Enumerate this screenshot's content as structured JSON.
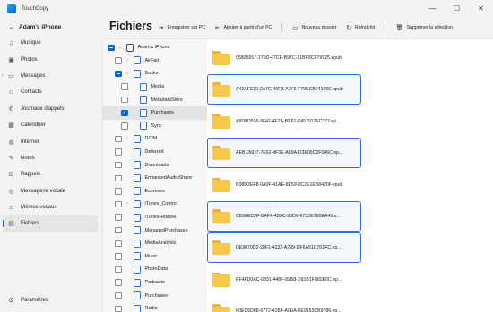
{
  "app": {
    "title": "TouchCopy"
  },
  "window_controls": {
    "minimize": "—",
    "maximize": "☐",
    "close": "✕"
  },
  "sidebar": {
    "device_name": "Adam's iPhone",
    "items": [
      {
        "label": "Musique",
        "icon": "music-icon",
        "glyph": "♫",
        "active": false
      },
      {
        "label": "Photos",
        "icon": "photo-icon",
        "glyph": "▣",
        "active": false
      },
      {
        "label": "Messages",
        "icon": "message-icon",
        "glyph": "▭",
        "active": false,
        "expander": "›"
      },
      {
        "label": "Contacts",
        "icon": "contacts-icon",
        "glyph": "☺",
        "active": false
      },
      {
        "label": "Journaux d'appels",
        "icon": "call-log-icon",
        "glyph": "✆",
        "active": false
      },
      {
        "label": "Calendrier",
        "icon": "calendar-icon",
        "glyph": "▦",
        "active": false
      },
      {
        "label": "Internet",
        "icon": "globe-icon",
        "glyph": "◍",
        "active": false
      },
      {
        "label": "Notes",
        "icon": "notes-icon",
        "glyph": "✎",
        "active": false
      },
      {
        "label": "Rappels",
        "icon": "reminders-icon",
        "glyph": "☑",
        "active": false
      },
      {
        "label": "Messagerie vocale",
        "icon": "voicemail-icon",
        "glyph": "◎",
        "active": false
      },
      {
        "label": "Mémos vocaux",
        "icon": "voice-memo-icon",
        "glyph": "♬",
        "active": false
      },
      {
        "label": "Fichiers",
        "icon": "files-icon",
        "glyph": "▤",
        "active": true
      }
    ],
    "settings_label": "Paramètres"
  },
  "header": {
    "title": "Fichiers",
    "toolbar": [
      {
        "label": "Enregistrer sur PC",
        "icon": "save-to-pc-icon",
        "glyph": "⇥",
        "name": "save-to-pc-button"
      },
      {
        "label": "Ajouter à partir d'un PC",
        "icon": "add-from-pc-icon",
        "glyph": "⇤",
        "name": "add-from-pc-button"
      },
      {
        "label": "Nouveau dossier",
        "icon": "new-folder-icon",
        "glyph": "▭",
        "name": "new-folder-button"
      },
      {
        "label": "Rafraîchir",
        "icon": "refresh-icon",
        "glyph": "↻",
        "name": "refresh-button"
      },
      {
        "label": "Supprimer la sélection",
        "icon": "trash-icon",
        "glyph": "🗑",
        "name": "delete-selection-button"
      }
    ]
  },
  "tree": {
    "rows": [
      {
        "label": "Adam's iPhone",
        "level": 0,
        "check": "partial",
        "expander": "⌄",
        "icon": "phone"
      },
      {
        "label": "AirFair",
        "level": 1,
        "check": "none",
        "expander": "›",
        "icon": "app"
      },
      {
        "label": "Books",
        "level": 1,
        "check": "partial",
        "expander": "⌄",
        "icon": "app"
      },
      {
        "label": "Media",
        "level": 2,
        "check": "none",
        "expander": "",
        "icon": "app"
      },
      {
        "label": "MetadataStore",
        "level": 2,
        "check": "none",
        "expander": "",
        "icon": "app"
      },
      {
        "label": "Purchases",
        "level": 2,
        "check": "checked",
        "expander": "",
        "icon": "app",
        "selected": true
      },
      {
        "label": "Sync",
        "level": 2,
        "check": "none",
        "expander": "",
        "icon": "app"
      },
      {
        "label": "DCIM",
        "level": 1,
        "check": "none",
        "expander": "›",
        "icon": "app"
      },
      {
        "label": "Deferred",
        "level": 1,
        "check": "none",
        "expander": "",
        "icon": "app"
      },
      {
        "label": "Downloads",
        "level": 1,
        "check": "none",
        "expander": "",
        "icon": "app"
      },
      {
        "label": "EnhancedAudioShare",
        "level": 1,
        "check": "none",
        "expander": "",
        "icon": "app"
      },
      {
        "label": "Espresso",
        "level": 1,
        "check": "none",
        "expander": "",
        "icon": "app"
      },
      {
        "label": "iTunes_Control",
        "level": 1,
        "check": "none",
        "expander": "›",
        "icon": "app"
      },
      {
        "label": "iTunesRestore",
        "level": 1,
        "check": "none",
        "expander": "",
        "icon": "app"
      },
      {
        "label": "ManagedPurchases",
        "level": 1,
        "check": "none",
        "expander": "",
        "icon": "app"
      },
      {
        "label": "MediaAnalysis",
        "level": 1,
        "check": "none",
        "expander": "",
        "icon": "app"
      },
      {
        "label": "Music",
        "level": 1,
        "check": "none",
        "expander": "",
        "icon": "app"
      },
      {
        "label": "PhotoData",
        "level": 1,
        "check": "none",
        "expander": "",
        "icon": "app"
      },
      {
        "label": "Podcasts",
        "level": 1,
        "check": "none",
        "expander": "",
        "icon": "app"
      },
      {
        "label": "Purchases",
        "level": 1,
        "check": "none",
        "expander": "",
        "icon": "app"
      },
      {
        "label": "Radio",
        "level": 1,
        "check": "none",
        "expander": "",
        "icon": "app"
      }
    ]
  },
  "files": [
    {
      "name": "05805657-170D-47CE-B97C-31BF9CF79925.epub",
      "selected": false
    },
    {
      "name": "A42AFE20-2A7C-49F3-A7F5-F79ECB64105E.epub",
      "selected": true
    },
    {
      "name": "A8D8D556-9F42-4F2A-BE61-7457017FC372.ep...",
      "selected": false
    },
    {
      "name": "AEB136D7-7E62-4F3E-A69A-D3E06C2F046C.ep...",
      "selected": true
    },
    {
      "name": "B08D2EF8-0A0F-41AE-8E59-0C2E1EB8420F.epub",
      "selected": false
    },
    {
      "name": "CB60ED2F-BAF4-4B9C-80D8-67C36780EA49.e...",
      "selected": true
    },
    {
      "name": "DE9070D2-28F1-4232-A799-DF6A51C701FC.ep...",
      "selected": true
    },
    {
      "name": "EF4FD0AC-6831-448F-82B8-D91B1F082E0C.ep...",
      "selected": false
    },
    {
      "name": "F0EC6D68-6772-41B4-A0EA-6E9153CB9786.ep...",
      "selected": false
    }
  ],
  "colors": {
    "accent": "#0b63c9",
    "folder": "#f7c84e",
    "folder_tab": "#e8b33f"
  }
}
